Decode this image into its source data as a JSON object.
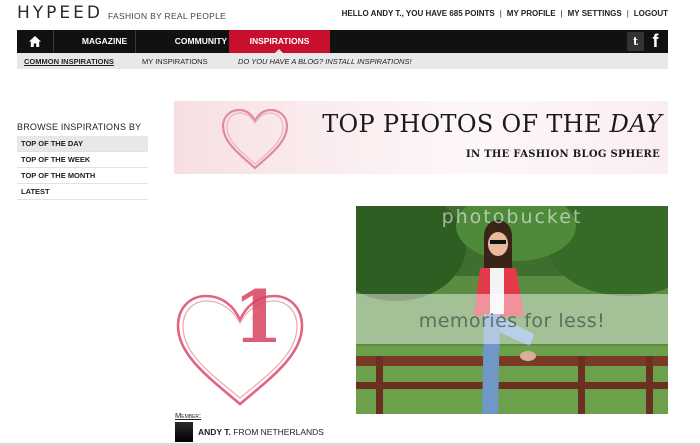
{
  "header": {
    "logo": "HYPEED",
    "tagline": "FASHION BY REAL PEOPLE",
    "user_greeting": "HELLO ANDY T., YOU HAVE 685 POINTS",
    "links": [
      "MY PROFILE",
      "MY SETTINGS",
      "LOGOUT"
    ],
    "separator": "|"
  },
  "main_nav": {
    "items": [
      "MAGAZINE",
      "COMMUNITY",
      "INSPIRATIONS"
    ],
    "active": "INSPIRATIONS",
    "home_icon": "home-icon",
    "social_icons": [
      "twitter-icon",
      "facebook-icon"
    ],
    "twitter_glyph": "t",
    "facebook_glyph": "f"
  },
  "sub_nav": {
    "items": [
      "COMMON INSPIRATIONS",
      "MY INSPIRATIONS",
      "DO YOU HAVE A BLOG? INSTALL INSPIRATIONS!"
    ],
    "active": "COMMON INSPIRATIONS"
  },
  "sidebar": {
    "title": "BROWSE INSPIRATIONS BY",
    "items": [
      "TOP OF THE DAY",
      "TOP OF THE WEEK",
      "TOP OF THE MONTH",
      "LATEST"
    ],
    "active": "TOP OF THE DAY"
  },
  "banner": {
    "title_main": "TOP PHOTOS OF THE",
    "title_emphasis": "DAY",
    "subtitle": "IN THE FASHION BLOG SPHERE"
  },
  "rank": {
    "number": "1"
  },
  "photo": {
    "watermark_top": "photobucket",
    "watermark_main": "memories for less!"
  },
  "member": {
    "label": "Member:",
    "name": "ANDY T.",
    "from": "FROM NETHERLANDS"
  },
  "colors": {
    "accent_red": "#c8102e",
    "nav_black": "#111111",
    "subnav_grey": "#e8e8e8",
    "heart_pink": "#e0667f"
  }
}
